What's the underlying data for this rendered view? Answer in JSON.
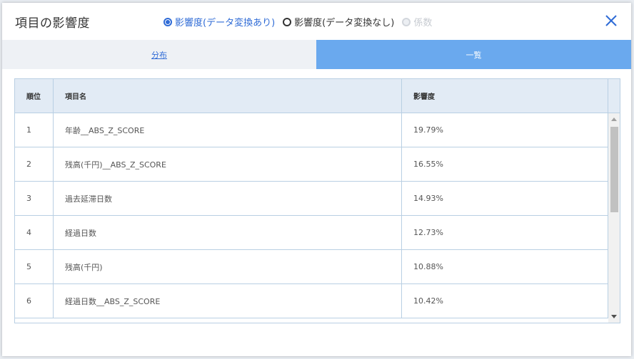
{
  "dialog": {
    "title": "項目の影響度",
    "close_icon": "close-icon",
    "radio_options": [
      {
        "label": "影響度(データ変換あり)",
        "state": "selected"
      },
      {
        "label": "影響度(データ変換なし)",
        "state": "unselected"
      },
      {
        "label": "係数",
        "state": "disabled"
      }
    ]
  },
  "tabs": [
    {
      "label": "分布",
      "active": false
    },
    {
      "label": "一覧",
      "active": true
    }
  ],
  "table": {
    "headers": [
      "順位",
      "項目名",
      "影響度"
    ],
    "rows": [
      [
        "1",
        "年齢__ABS_Z_SCORE",
        "19.79%"
      ],
      [
        "2",
        "残高(千円)__ABS_Z_SCORE",
        "16.55%"
      ],
      [
        "3",
        "過去延滞日数",
        "14.93%"
      ],
      [
        "4",
        "経過日数",
        "12.73%"
      ],
      [
        "5",
        "残高(千円)",
        "10.88%"
      ],
      [
        "6",
        "経過日数__ABS_Z_SCORE",
        "10.42%"
      ]
    ]
  },
  "colors": {
    "accent": "#2f6bd6",
    "active_tab": "#6aa9ee",
    "header_bg": "#e2ebf5",
    "border": "#b9cfe3"
  }
}
